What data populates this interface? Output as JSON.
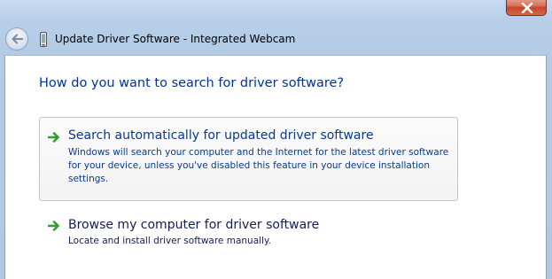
{
  "window": {
    "title": "Update Driver Software - Integrated Webcam"
  },
  "content": {
    "main_instruction": "How do you want to search for driver software?",
    "options": [
      {
        "title": "Search automatically for updated driver software",
        "description": "Windows will search your computer and the Internet for the latest driver software for your device, unless you've disabled this feature in your device installation settings.",
        "state": "hover"
      },
      {
        "title": "Browse my computer for driver software",
        "description": "Locate and install driver software manually.",
        "state": "normal"
      }
    ]
  },
  "icons": {
    "close": "close-icon",
    "back": "back-arrow-icon",
    "device": "webcam-device-icon",
    "option_arrow": "green-arrow-icon"
  },
  "colors": {
    "instruction_text": "#003399",
    "link_text": "#151c55",
    "arrow_green": "#2e9e2e",
    "close_red": "#c5462d"
  }
}
